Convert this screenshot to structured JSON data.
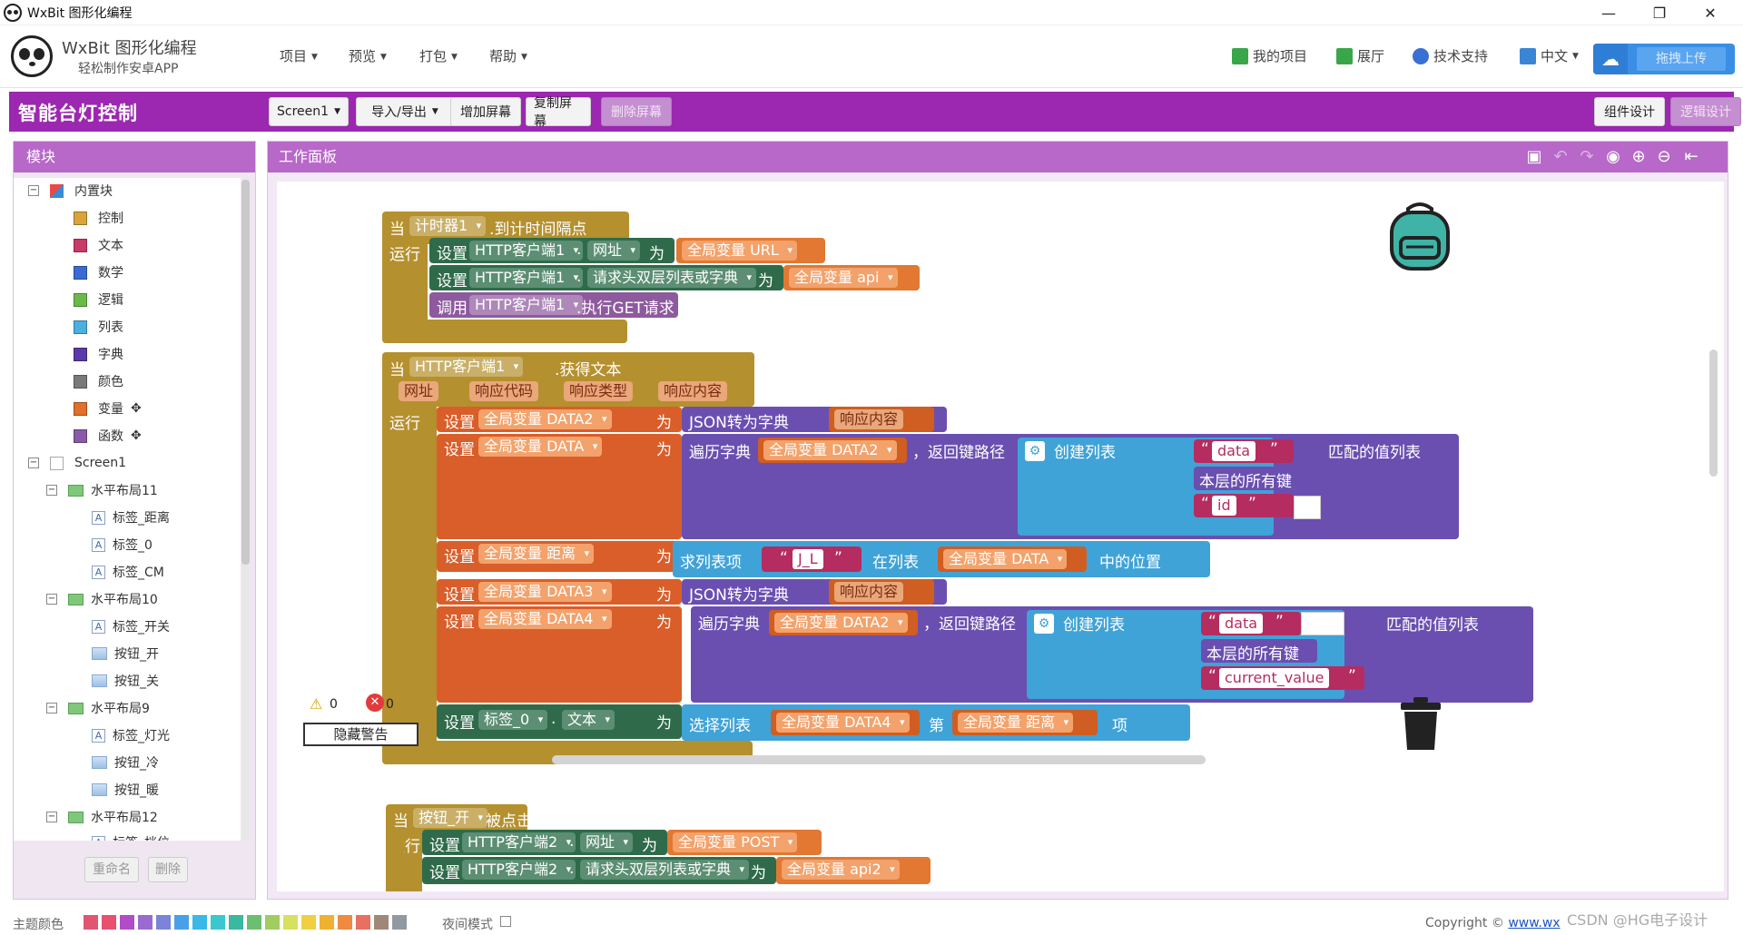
{
  "window": {
    "title": "WxBit 图形化编程",
    "min": "—",
    "max": "❐",
    "close": "✕"
  },
  "header": {
    "brand": "WxBit 图形化编程",
    "subtitle": "轻松制作安卓APP",
    "menu": [
      "项目",
      "预览",
      "打包",
      "帮助"
    ],
    "right": [
      {
        "label": "我的项目",
        "icon": "list-icon",
        "color": "#3aa64a"
      },
      {
        "label": "展厅",
        "icon": "grid-icon",
        "color": "#3aa64a"
      },
      {
        "label": "技术支持",
        "icon": "qq-icon",
        "color": "#3a6fd4"
      },
      {
        "label": "中文",
        "icon": "language-icon",
        "color": "#3a86d4"
      }
    ],
    "upload": "拖拽上传"
  },
  "project": {
    "title": "智能台灯控制",
    "screen_select": "Screen1",
    "import_export": "导入/导出",
    "add_screen": "增加屏幕",
    "copy_screen": "复制屏幕",
    "delete_screen": "删除屏幕",
    "designer": "组件设计",
    "blocks": "逻辑设计"
  },
  "left_panel": {
    "title": "模块",
    "builtin": "内置块",
    "categories": [
      {
        "label": "控制",
        "color": "#d9a53a"
      },
      {
        "label": "文本",
        "color": "#c73a6a"
      },
      {
        "label": "数学",
        "color": "#3a6ad4"
      },
      {
        "label": "逻辑",
        "color": "#6aba4a"
      },
      {
        "label": "列表",
        "color": "#4ab0e0"
      },
      {
        "label": "字典",
        "color": "#5a3aa8"
      },
      {
        "label": "颜色",
        "color": "#7a7a7a"
      },
      {
        "label": "变量",
        "color": "#e0702a"
      },
      {
        "label": "函数",
        "color": "#8a5aa8"
      }
    ],
    "screen": "Screen1",
    "tree": [
      {
        "label": "水平布局11",
        "kind": "layout",
        "children": [
          {
            "label": "标签_距离",
            "kind": "label"
          },
          {
            "label": "标签_0",
            "kind": "label"
          },
          {
            "label": "标签_CM",
            "kind": "label"
          }
        ]
      },
      {
        "label": "水平布局10",
        "kind": "layout",
        "children": [
          {
            "label": "标签_开关",
            "kind": "label"
          },
          {
            "label": "按钮_开",
            "kind": "button"
          },
          {
            "label": "按钮_关",
            "kind": "button"
          }
        ]
      },
      {
        "label": "水平布局9",
        "kind": "layout",
        "children": [
          {
            "label": "标签_灯光",
            "kind": "label"
          },
          {
            "label": "按钮_冷",
            "kind": "button"
          },
          {
            "label": "按钮_暖",
            "kind": "button"
          }
        ]
      },
      {
        "label": "水平布局12",
        "kind": "layout",
        "children": [
          {
            "label": "标签_档位",
            "kind": "label"
          }
        ]
      }
    ],
    "rename": "重命名",
    "delete": "删除"
  },
  "workspace": {
    "title": "工作面板",
    "warnings_count": "0",
    "errors_count": "0",
    "hide_warnings": "隐藏警告",
    "blocks": {
      "b1": {
        "when": "当",
        "component": "计时器1",
        "event": ".到计时间隔点",
        "run": "运行",
        "s1": {
          "set": "设置",
          "comp": "HTTP客户端1",
          "dot": ".",
          "prop": "网址",
          "to": "为",
          "var": "全局变量 URL"
        },
        "s2": {
          "set": "设置",
          "comp": "HTTP客户端1",
          "dot": ".",
          "prop": "请求头双层列表或字典",
          "to": "为",
          "var": "全局变量 api"
        },
        "s3": {
          "call": "调用",
          "comp": "HTTP客户端1",
          "method": ".执行GET请求"
        }
      },
      "b2": {
        "when": "当",
        "component": "HTTP客户端1",
        "event": ".获得文本",
        "run": "运行",
        "params": [
          "网址",
          "响应代码",
          "响应类型",
          "响应内容"
        ],
        "r1": {
          "set": "设置",
          "var": "全局变量 DATA2",
          "to": "为",
          "fn": "JSON转为字典",
          "arg": "响应内容"
        },
        "r2": {
          "set": "设置",
          "var": "全局变量 DATA",
          "to": "为",
          "fn": "遍历字典",
          "dict": "全局变量 DATA2",
          "path": "，返回键路径",
          "mk": "创建列表",
          "k1": "data",
          "k2": "本层的所有键",
          "k3": "id",
          "tail": "匹配的值列表"
        },
        "r3": {
          "set": "设置",
          "var": "全局变量 距离",
          "to": "为",
          "fn": "求列表项",
          "item": "J_L",
          "inlist": "在列表",
          "list": "全局变量 DATA",
          "pos": "中的位置"
        },
        "r4": {
          "set": "设置",
          "var": "全局变量 DATA3",
          "to": "为",
          "fn": "JSON转为字典",
          "arg": "响应内容"
        },
        "r5": {
          "set": "设置",
          "var": "全局变量 DATA4",
          "to": "为",
          "fn": "遍历字典",
          "dict": "全局变量 DATA2",
          "path": "，返回键路径",
          "mk": "创建列表",
          "k1": "data",
          "k2": "本层的所有键",
          "k3": "current_value",
          "tail": "匹配的值列表"
        },
        "r6": {
          "set": "设置",
          "comp": "标签_0",
          "dot": ".",
          "prop": "文本",
          "to": "为",
          "fn": "选择列表",
          "list": "全局变量 DATA4",
          "nth": "第",
          "idx": "全局变量 距离",
          "item": "项"
        }
      },
      "b3": {
        "when": "当",
        "component": "按钮_开",
        "event": "被点击",
        "run": "运行",
        "s1": {
          "set": "设置",
          "comp": "HTTP客户端2",
          "dot": ".",
          "prop": "网址",
          "to": "为",
          "var": "全局变量 POST"
        },
        "s2": {
          "set": "设置",
          "comp": "HTTP客户端2",
          "dot": ".",
          "prop": "请求头双层列表或字典",
          "to": "为",
          "var": "全局变量 api2"
        }
      }
    }
  },
  "footer": {
    "theme_label": "主题颜色",
    "swatches": [
      "#e05570",
      "#e8506e",
      "#b04cc8",
      "#9a6ad0",
      "#7a84d8",
      "#4aa0e8",
      "#3ab8e8",
      "#3ac8d0",
      "#3ab8a0",
      "#6ac070",
      "#a0cc60",
      "#d8e060",
      "#f0d040",
      "#f0b030",
      "#f08a40",
      "#e87060",
      "#a08878",
      "#909aa0"
    ],
    "night": "夜间模式",
    "copyright": "Copyright ©",
    "copyright_link": "www.wx",
    "watermark": "CSDN @HG电子设计"
  }
}
